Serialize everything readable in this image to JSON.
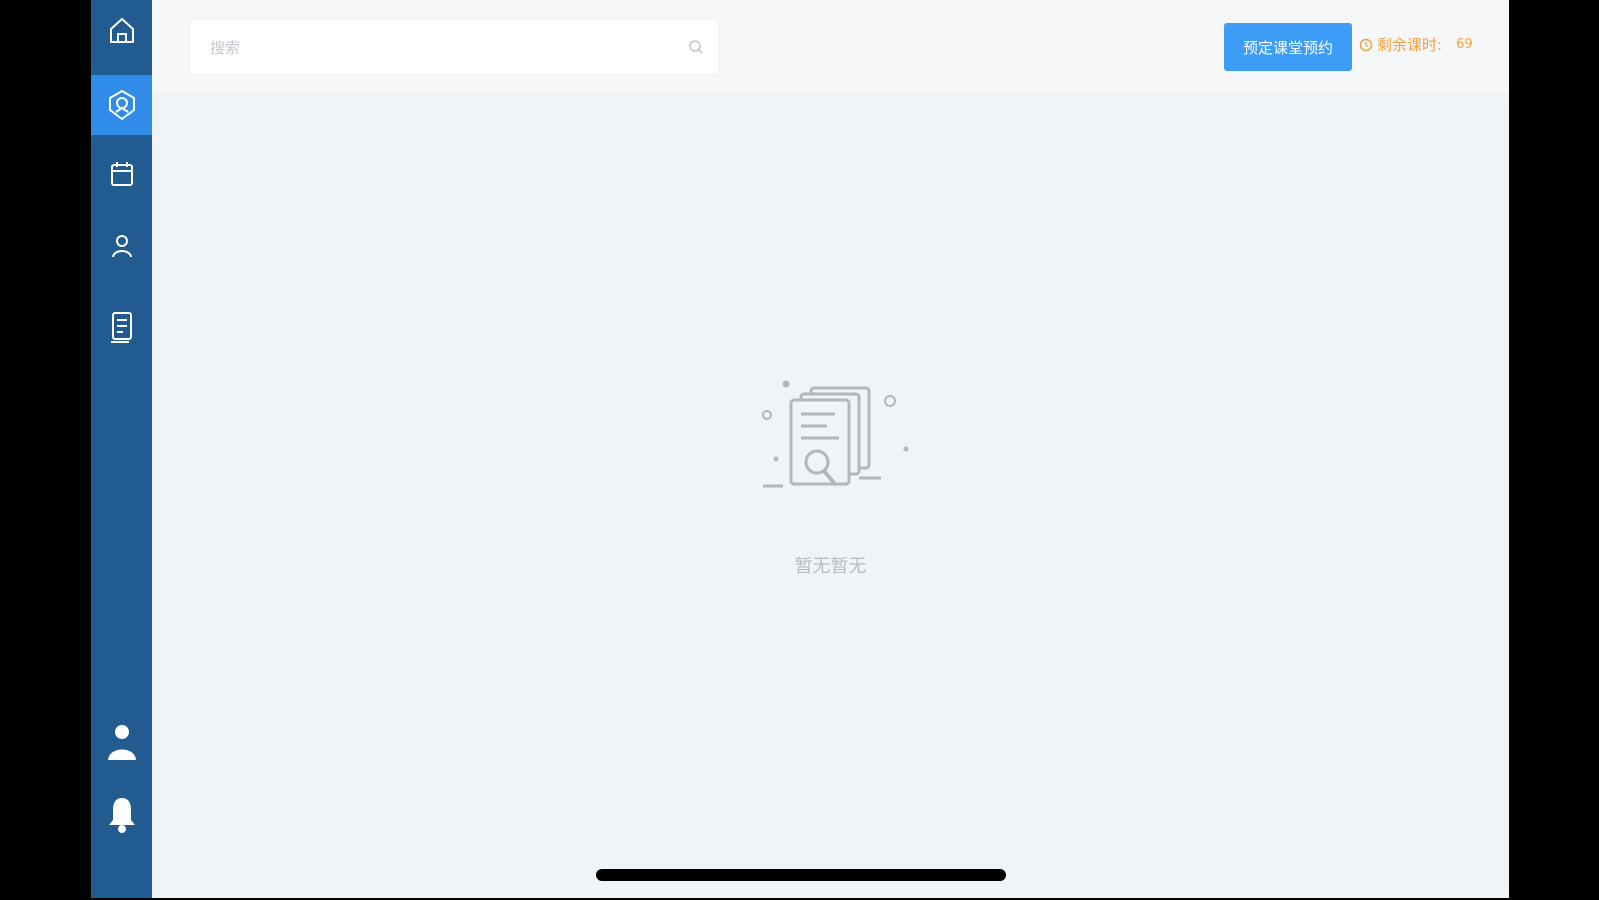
{
  "search": {
    "placeholder": "搜索"
  },
  "header": {
    "primary_button_label": "预定课堂预约",
    "remaining_label": "剩余课时:",
    "remaining_value": "69"
  },
  "sidebar": {
    "items": [
      {
        "icon": "home-icon"
      },
      {
        "icon": "course-icon",
        "active": true
      },
      {
        "icon": "calendar-icon"
      },
      {
        "icon": "student-icon"
      },
      {
        "icon": "report-icon"
      }
    ],
    "bottom": [
      {
        "icon": "user-icon"
      },
      {
        "icon": "bell-icon"
      }
    ]
  },
  "empty_state": {
    "text": "暂无暂无"
  },
  "colors": {
    "sidebar_bg": "#215b8f",
    "sidebar_active": "#2f8ce8",
    "primary": "#3d9cf6",
    "warning": "#f0a23b"
  }
}
